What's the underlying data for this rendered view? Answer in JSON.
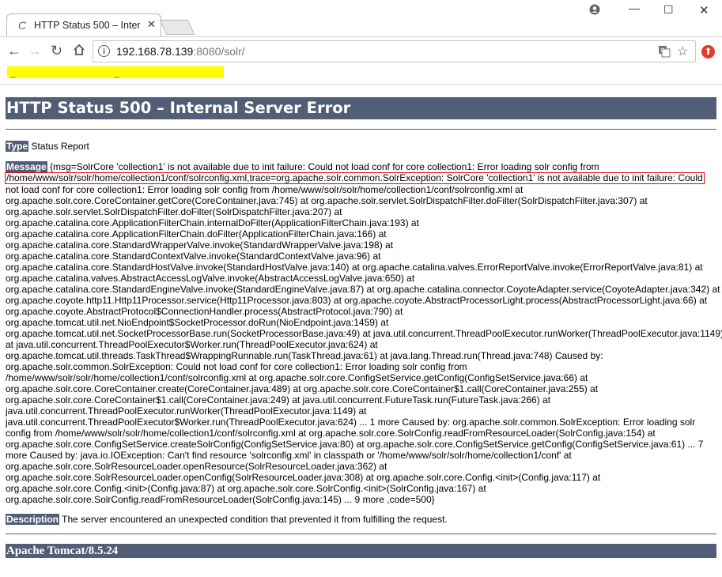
{
  "browser": {
    "tab_title": "HTTP Status 500 – Inter",
    "url_host": "192.168.78.139",
    "url_rest": ":8080/solr/"
  },
  "page": {
    "heading": "HTTP Status 500 – Internal Server Error",
    "type_label": "Type",
    "type_value": "Status Report",
    "message_label": "Message",
    "message_lines": [
      "{msg=SolrCore 'collection1' is not available due to init failure: Could not load conf for core collection1: Error loading solr config from",
      "/home/www/solr/solr/home/collection1/conf/solrconfig.xml,trace=org.apache.solr.common.SolrException: SolrCore 'collection1' is not available due to init failure: Could",
      "not load conf for core collection1: Error loading solr config from /home/www/solr/solr/home/collection1/conf/solrconfig.xml at",
      "org.apache.solr.core.CoreContainer.getCore(CoreContainer.java:745) at org.apache.solr.servlet.SolrDispatchFilter.doFilter(SolrDispatchFilter.java:307) at",
      "org.apache.solr.servlet.SolrDispatchFilter.doFilter(SolrDispatchFilter.java:207) at",
      "org.apache.catalina.core.ApplicationFilterChain.internalDoFilter(ApplicationFilterChain.java:193) at",
      "org.apache.catalina.core.ApplicationFilterChain.doFilter(ApplicationFilterChain.java:166) at",
      "org.apache.catalina.core.StandardWrapperValve.invoke(StandardWrapperValve.java:198) at",
      "org.apache.catalina.core.StandardContextValve.invoke(StandardContextValve.java:96) at",
      "org.apache.catalina.core.StandardHostValve.invoke(StandardHostValve.java:140) at org.apache.catalina.valves.ErrorReportValve.invoke(ErrorReportValve.java:81) at",
      "org.apache.catalina.valves.AbstractAccessLogValve.invoke(AbstractAccessLogValve.java:650) at",
      "org.apache.catalina.core.StandardEngineValve.invoke(StandardEngineValve.java:87) at org.apache.catalina.connector.CoyoteAdapter.service(CoyoteAdapter.java:342) at",
      "org.apache.coyote.http11.Http11Processor.service(Http11Processor.java:803) at org.apache.coyote.AbstractProcessorLight.process(AbstractProcessorLight.java:66) at",
      "org.apache.coyote.AbstractProtocol$ConnectionHandler.process(AbstractProtocol.java:790) at",
      "org.apache.tomcat.util.net.NioEndpoint$SocketProcessor.doRun(NioEndpoint.java:1459) at",
      "org.apache.tomcat.util.net.SocketProcessorBase.run(SocketProcessorBase.java:49) at java.util.concurrent.ThreadPoolExecutor.runWorker(ThreadPoolExecutor.java:1149)",
      "at java.util.concurrent.ThreadPoolExecutor$Worker.run(ThreadPoolExecutor.java:624) at",
      "org.apache.tomcat.util.threads.TaskThread$WrappingRunnable.run(TaskThread.java:61) at java.lang.Thread.run(Thread.java:748) Caused by:",
      "org.apache.solr.common.SolrException: Could not load conf for core collection1: Error loading solr config from",
      "/home/www/solr/solr/home/collection1/conf/solrconfig.xml at org.apache.solr.core.ConfigSetService.getConfig(ConfigSetService.java:66) at",
      "org.apache.solr.core.CoreContainer.create(CoreContainer.java:489) at org.apache.solr.core.CoreContainer$1.call(CoreContainer.java:255) at",
      "org.apache.solr.core.CoreContainer$1.call(CoreContainer.java:249) at java.util.concurrent.FutureTask.run(FutureTask.java:266) at",
      "java.util.concurrent.ThreadPoolExecutor.runWorker(ThreadPoolExecutor.java:1149) at",
      "java.util.concurrent.ThreadPoolExecutor$Worker.run(ThreadPoolExecutor.java:624) ... 1 more Caused by: org.apache.solr.common.SolrException: Error loading solr",
      "config from /home/www/solr/solr/home/collection1/conf/solrconfig.xml at org.apache.solr.core.SolrConfig.readFromResourceLoader(SolrConfig.java:154) at",
      "org.apache.solr.core.ConfigSetService.createSolrConfig(ConfigSetService.java:80) at org.apache.solr.core.ConfigSetService.getConfig(ConfigSetService.java:61) ... 7",
      "more Caused by: java.io.IOException: Can't find resource 'solrconfig.xml' in classpath or '/home/www/solr/solr/home/collection1/conf' at",
      "org.apache.solr.core.SolrResourceLoader.openResource(SolrResourceLoader.java:362) at",
      "org.apache.solr.core.SolrResourceLoader.openConfig(SolrResourceLoader.java:308) at org.apache.solr.core.Config.<init>(Config.java:117) at",
      "org.apache.solr.core.Config.<init>(Config.java:87) at org.apache.solr.core.SolrConfig.<init>(SolrConfig.java:167) at",
      "org.apache.solr.core.SolrConfig.readFromResourceLoader(SolrConfig.java:145) ... 9 more ,code=500}"
    ],
    "description_label": "Description",
    "description_value": "The server encountered an unexpected condition that prevented it from fulfilling the request.",
    "footer": "Apache Tomcat/8.5.24"
  }
}
